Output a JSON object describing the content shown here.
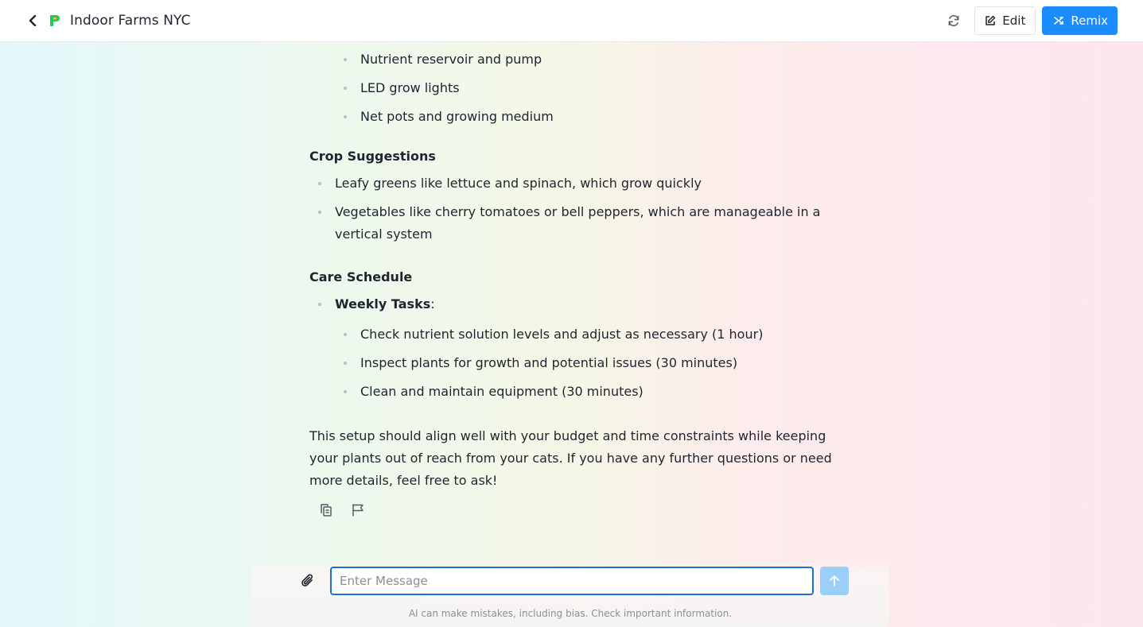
{
  "header": {
    "title": "Indoor Farms NYC",
    "edit_label": "Edit",
    "remix_label": "Remix",
    "icons": [
      "back-chevron-icon",
      "app-logo-icon",
      "refresh-icon",
      "edit-pencil-icon",
      "remix-icon"
    ]
  },
  "content": {
    "equipment_items": [
      "Nutrient reservoir and pump",
      "LED grow lights",
      "Net pots and growing medium"
    ],
    "crop_heading": "Crop Suggestions",
    "crop_items": [
      "Leafy greens like lettuce and spinach, which grow quickly",
      "Vegetables like cherry tomatoes or bell peppers, which are manageable in a vertical system"
    ],
    "care_heading": "Care Schedule",
    "weekly_label": "Weekly Tasks",
    "weekly_colon": ":",
    "weekly_items": [
      "Check nutrient solution levels and adjust as necessary (1 hour)",
      "Inspect plants for growth and potential issues (30 minutes)",
      "Clean and maintain equipment (30 minutes)"
    ],
    "closing": "This setup should align well with your budget and time constraints while keeping your plants out of reach from your cats. If you have any further questions or need more details, feel free to ask!"
  },
  "composer": {
    "placeholder": "Enter Message",
    "value": "",
    "disclaimer": "AI can make mistakes, including bias. Check important information."
  },
  "colors": {
    "accent": "#1a8cff",
    "input_border": "#1f6fd6",
    "send_disabled": "#9ccff8",
    "logo_green": "#22c55e",
    "logo_yellow": "#facc15"
  }
}
